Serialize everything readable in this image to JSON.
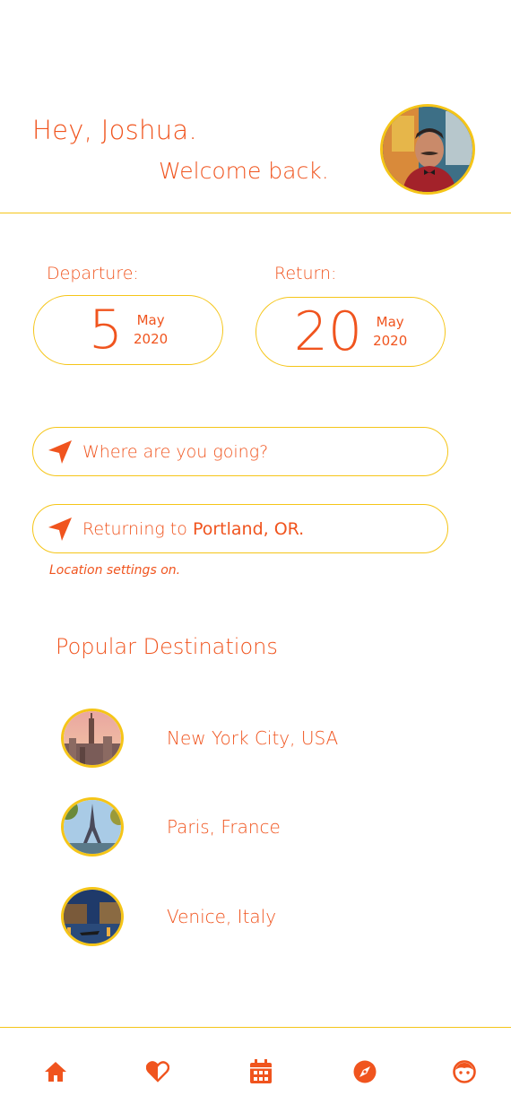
{
  "header": {
    "greeting": "Hey, Joshua.",
    "welcome": "Welcome back.",
    "avatar_icon": "user-avatar-photo"
  },
  "dates": {
    "departure": {
      "label": "Departure:",
      "day": "5",
      "month": "May",
      "year": "2020"
    },
    "return": {
      "label": "Return:",
      "day": "20",
      "month": "May",
      "year": "2020"
    }
  },
  "destination_field": {
    "icon": "location-arrow-icon",
    "placeholder": "Where are you going?"
  },
  "returning_field": {
    "icon": "location-arrow-icon",
    "prefix": "Returning to",
    "city": "Portland, OR."
  },
  "location_note": "Location settings on.",
  "popular": {
    "title": "Popular Destinations",
    "items": [
      {
        "name": "New York City, USA",
        "image": "new-york-skyline-photo"
      },
      {
        "name": "Paris, France",
        "image": "eiffel-tower-photo"
      },
      {
        "name": "Venice, Italy",
        "image": "venice-canal-photo"
      }
    ]
  },
  "nav": {
    "items": [
      "home-icon",
      "heart-icon",
      "calendar-icon",
      "compass-icon",
      "profile-icon"
    ]
  },
  "colors": {
    "accent": "#f0541e",
    "border": "#f5c518",
    "background": "#ffffff"
  }
}
